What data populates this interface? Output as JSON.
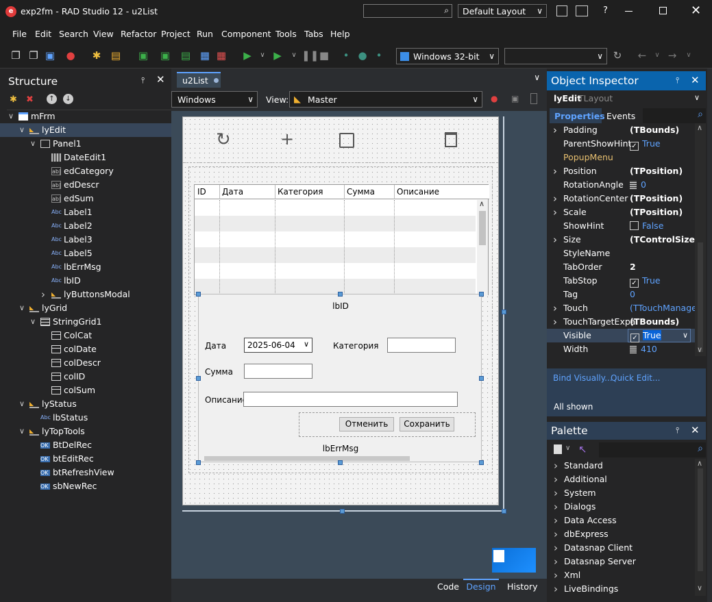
{
  "window": {
    "title": "exp2fm - RAD Studio 12 - u2List",
    "layout_combo": "Default Layout",
    "help": "?"
  },
  "menu": [
    "File",
    "Edit",
    "Search",
    "View",
    "Refactor",
    "Project",
    "Run",
    "Component",
    "Tools",
    "Tabs",
    "Help"
  ],
  "toolbar": {
    "platform": "Windows 32-bit",
    "config": ""
  },
  "structure": {
    "title": "Structure",
    "items": [
      {
        "label": "mFrm",
        "indent": 0,
        "icon": "form-icon",
        "exp": "v"
      },
      {
        "label": "lyEdit",
        "indent": 1,
        "icon": "layout-icon",
        "exp": "v",
        "selected": true
      },
      {
        "label": "Panel1",
        "indent": 2,
        "icon": "panel-icon",
        "exp": "v"
      },
      {
        "label": "DateEdit1",
        "indent": 3,
        "icon": "calendar-icon",
        "exp": ""
      },
      {
        "label": "edCategory",
        "indent": 3,
        "icon": "edit-icon",
        "exp": ""
      },
      {
        "label": "edDescr",
        "indent": 3,
        "icon": "edit-icon",
        "exp": ""
      },
      {
        "label": "edSum",
        "indent": 3,
        "icon": "edit-icon",
        "exp": ""
      },
      {
        "label": "Label1",
        "indent": 3,
        "icon": "label-icon",
        "exp": ""
      },
      {
        "label": "Label2",
        "indent": 3,
        "icon": "label-icon",
        "exp": ""
      },
      {
        "label": "Label3",
        "indent": 3,
        "icon": "label-icon",
        "exp": ""
      },
      {
        "label": "Label5",
        "indent": 3,
        "icon": "label-icon",
        "exp": ""
      },
      {
        "label": "lbErrMsg",
        "indent": 3,
        "icon": "label-icon",
        "exp": ""
      },
      {
        "label": "lbID",
        "indent": 3,
        "icon": "label-icon",
        "exp": ""
      },
      {
        "label": "lyButtonsModal",
        "indent": 3,
        "icon": "layout-icon",
        "exp": ">"
      },
      {
        "label": "lyGrid",
        "indent": 1,
        "icon": "layout-icon",
        "exp": "v"
      },
      {
        "label": "StringGrid1",
        "indent": 2,
        "icon": "grid-icon",
        "exp": "v"
      },
      {
        "label": "ColCat",
        "indent": 3,
        "icon": "column-icon",
        "exp": ""
      },
      {
        "label": "colDate",
        "indent": 3,
        "icon": "column-icon",
        "exp": ""
      },
      {
        "label": "colDescr",
        "indent": 3,
        "icon": "column-icon",
        "exp": ""
      },
      {
        "label": "colID",
        "indent": 3,
        "icon": "column-icon",
        "exp": ""
      },
      {
        "label": "colSum",
        "indent": 3,
        "icon": "column-icon",
        "exp": ""
      },
      {
        "label": "lyStatus",
        "indent": 1,
        "icon": "layout-icon",
        "exp": "v"
      },
      {
        "label": "lbStatus",
        "indent": 2,
        "icon": "label-icon",
        "exp": ""
      },
      {
        "label": "lyTopTools",
        "indent": 1,
        "icon": "layout-icon",
        "exp": "v"
      },
      {
        "label": "BtDelRec",
        "indent": 2,
        "icon": "button-icon",
        "exp": ""
      },
      {
        "label": "btEditRec",
        "indent": 2,
        "icon": "button-icon",
        "exp": ""
      },
      {
        "label": "btRefreshView",
        "indent": 2,
        "icon": "button-icon",
        "exp": ""
      },
      {
        "label": "sbNewRec",
        "indent": 2,
        "icon": "button-icon",
        "exp": ""
      }
    ]
  },
  "editor": {
    "tab": "u2List",
    "style_combo": "Windows",
    "view_label": "View:",
    "view_combo": "Master",
    "bottom_tabs": [
      "Code",
      "Design",
      "History"
    ]
  },
  "form": {
    "grid_headers": [
      "ID",
      "Дата",
      "Категория",
      "Сумма",
      "Описание"
    ],
    "lbid": "lbID",
    "date_label": "Дата",
    "date_value": "2025-06-04",
    "category_label": "Категория",
    "sum_label": "Сумма",
    "descr_label": "Описание",
    "cancel": "Отменить",
    "save": "Сохранить",
    "errmsg": "lbErrMsg"
  },
  "inspector": {
    "title": "Object Inspector",
    "obj_name": "lyEdit",
    "obj_type": "TLayout",
    "tab_props": "Properties",
    "tab_events": "Events",
    "props": [
      {
        "name": "Padding",
        "value": "(TBounds)",
        "exp": true,
        "style": "bold"
      },
      {
        "name": "ParentShowHint",
        "value": "True",
        "check": true,
        "checked": true,
        "style": "blue"
      },
      {
        "name": "PopupMenu",
        "value": "",
        "style": "link"
      },
      {
        "name": "Position",
        "value": "(TPosition)",
        "exp": true,
        "style": "bold"
      },
      {
        "name": "RotationAngle",
        "value": "0",
        "style": "bluenum"
      },
      {
        "name": "RotationCenter",
        "value": "(TPosition)",
        "exp": true,
        "style": "bold"
      },
      {
        "name": "Scale",
        "value": "(TPosition)",
        "exp": true,
        "style": "bold"
      },
      {
        "name": "ShowHint",
        "value": "False",
        "check": true,
        "checked": false,
        "style": "blue"
      },
      {
        "name": "Size",
        "value": "(TControlSize)",
        "exp": true,
        "style": "bold"
      },
      {
        "name": "StyleName",
        "value": "",
        "style": "bold"
      },
      {
        "name": "TabOrder",
        "value": "2",
        "style": "bold"
      },
      {
        "name": "TabStop",
        "value": "True",
        "check": true,
        "checked": true,
        "style": "blue"
      },
      {
        "name": "Tag",
        "value": "0",
        "style": "blue"
      },
      {
        "name": "Touch",
        "value": "(TTouchManager)",
        "exp": true,
        "style": "blue"
      },
      {
        "name": "TouchTargetExpa",
        "value": "(TBounds)",
        "exp": true,
        "style": "bold"
      },
      {
        "name": "Visible",
        "value": "True",
        "check": true,
        "checked": true,
        "style": "selected"
      },
      {
        "name": "Width",
        "value": "410",
        "style": "bluenum"
      }
    ],
    "bind_visually": "Bind Visually...",
    "quick_edit": "Quick Edit...",
    "all_shown": "All shown"
  },
  "palette": {
    "title": "Palette",
    "items": [
      "Standard",
      "Additional",
      "System",
      "Dialogs",
      "Data Access",
      "dbExpress",
      "Datasnap Client",
      "Datasnap Server",
      "Xml",
      "LiveBindings"
    ]
  }
}
